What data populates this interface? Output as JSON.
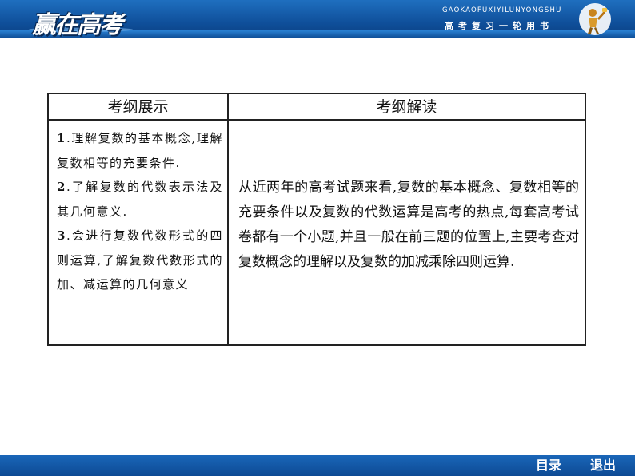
{
  "header": {
    "logo_text": "赢在高考",
    "brand_pinyin": "GAOKAOFUXIYILUNYONGSHU",
    "brand_cn": "高考复习一轮用书",
    "mascot_icon": "trophy-mascot-icon",
    "colors": {
      "banner": "#0f4f9a",
      "band": "#2a82d4"
    }
  },
  "table": {
    "headers": [
      "考纲展示",
      "考纲解读"
    ],
    "left_items": [
      {
        "num": "1",
        "text": ".理解复数的基本概念,理解复数相等的充要条件."
      },
      {
        "num": "2",
        "text": ".了解复数的代数表示法及其几何意义."
      },
      {
        "num": "3",
        "text": ".会进行复数代数形式的四则运算,了解复数代数形式的加、减运算的几何意义"
      }
    ],
    "right_text": "从近两年的高考试题来看,复数的基本概念、复数相等的充要条件以及复数的代数运算是高考的热点,每套高考试卷都有一个小题,并且一般在前三题的位置上,主要考查对复数概念的理解以及复数的加减乘除四则运算."
  },
  "footer": {
    "toc_label": "目录",
    "exit_label": "退出",
    "color": "#0d4a94"
  }
}
